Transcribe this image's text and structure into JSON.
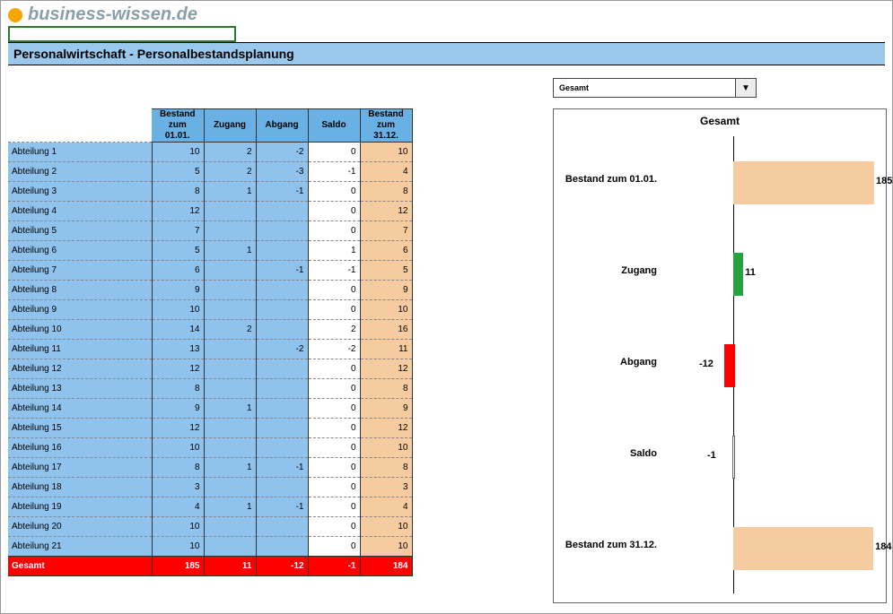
{
  "logo_text": "business-wissen.de",
  "title": "Personalwirtschaft - Personalbestandsplanung",
  "dropdown": {
    "selected": "Gesamt"
  },
  "columns": [
    "Bestand zum 01.01.",
    "Zugang",
    "Abgang",
    "Saldo",
    "Bestand zum 31.12."
  ],
  "rows": [
    {
      "name": "Abteilung 1",
      "start": 10,
      "in": 2,
      "out": -2,
      "saldo": 0,
      "end": 10
    },
    {
      "name": "Abteilung 2",
      "start": 5,
      "in": 2,
      "out": -3,
      "saldo": -1,
      "end": 4
    },
    {
      "name": "Abteilung 3",
      "start": 8,
      "in": 1,
      "out": -1,
      "saldo": 0,
      "end": 8
    },
    {
      "name": "Abteilung 4",
      "start": 12,
      "in": null,
      "out": null,
      "saldo": 0,
      "end": 12
    },
    {
      "name": "Abteilung 5",
      "start": 7,
      "in": null,
      "out": null,
      "saldo": 0,
      "end": 7
    },
    {
      "name": "Abteilung 6",
      "start": 5,
      "in": 1,
      "out": null,
      "saldo": 1,
      "end": 6
    },
    {
      "name": "Abteilung 7",
      "start": 6,
      "in": null,
      "out": -1,
      "saldo": -1,
      "end": 5
    },
    {
      "name": "Abteilung 8",
      "start": 9,
      "in": null,
      "out": null,
      "saldo": 0,
      "end": 9
    },
    {
      "name": "Abteilung 9",
      "start": 10,
      "in": null,
      "out": null,
      "saldo": 0,
      "end": 10
    },
    {
      "name": "Abteilung 10",
      "start": 14,
      "in": 2,
      "out": null,
      "saldo": 2,
      "end": 16
    },
    {
      "name": "Abteilung 11",
      "start": 13,
      "in": null,
      "out": -2,
      "saldo": -2,
      "end": 11
    },
    {
      "name": "Abteilung 12",
      "start": 12,
      "in": null,
      "out": null,
      "saldo": 0,
      "end": 12
    },
    {
      "name": "Abteilung 13",
      "start": 8,
      "in": null,
      "out": null,
      "saldo": 0,
      "end": 8
    },
    {
      "name": "Abteilung 14",
      "start": 9,
      "in": 1,
      "out": null,
      "saldo": 0,
      "end": 9
    },
    {
      "name": "Abteilung 15",
      "start": 12,
      "in": null,
      "out": null,
      "saldo": 0,
      "end": 12
    },
    {
      "name": "Abteilung 16",
      "start": 10,
      "in": null,
      "out": null,
      "saldo": 0,
      "end": 10
    },
    {
      "name": "Abteilung 17",
      "start": 8,
      "in": 1,
      "out": -1,
      "saldo": 0,
      "end": 8
    },
    {
      "name": "Abteilung 18",
      "start": 3,
      "in": null,
      "out": null,
      "saldo": 0,
      "end": 3
    },
    {
      "name": "Abteilung 19",
      "start": 4,
      "in": 1,
      "out": -1,
      "saldo": 0,
      "end": 4
    },
    {
      "name": "Abteilung 20",
      "start": 10,
      "in": null,
      "out": null,
      "saldo": 0,
      "end": 10
    },
    {
      "name": "Abteilung 21",
      "start": 10,
      "in": null,
      "out": null,
      "saldo": 0,
      "end": 10
    }
  ],
  "total": {
    "name": "Gesamt",
    "start": 185,
    "in": 11,
    "out": -12,
    "saldo": -1,
    "end": 184
  },
  "chart_data": {
    "type": "bar",
    "orientation": "horizontal",
    "title": "Gesamt",
    "categories": [
      "Bestand zum 01.01.",
      "Zugang",
      "Abgang",
      "Saldo",
      "Bestand zum 31.12."
    ],
    "values": [
      185,
      11,
      -12,
      -1,
      184
    ],
    "colors": [
      "#f6cba0",
      "#25a33f",
      "#ff0000",
      "#ffffff",
      "#f6cba0"
    ],
    "xlim": [
      -185,
      185
    ]
  }
}
